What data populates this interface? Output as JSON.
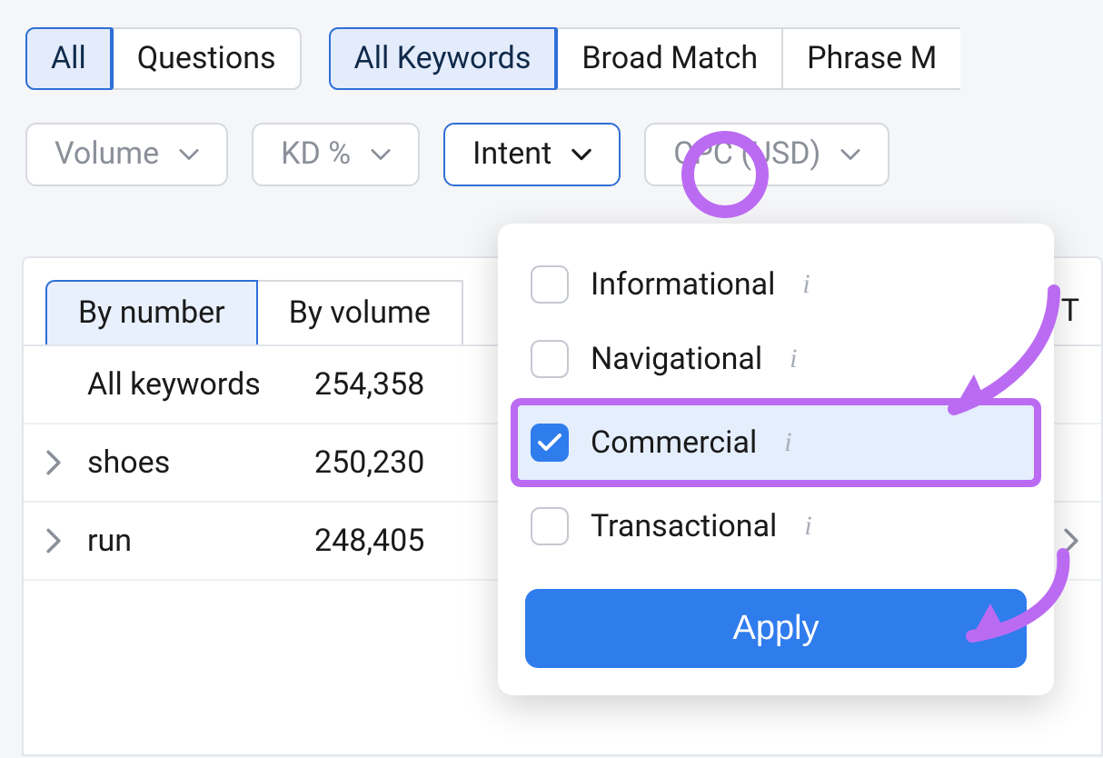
{
  "tabGroups": {
    "type": [
      {
        "label": "All",
        "active": true
      },
      {
        "label": "Questions",
        "active": false
      }
    ],
    "match": [
      {
        "label": "All Keywords",
        "active": true
      },
      {
        "label": "Broad Match",
        "active": false
      },
      {
        "label": "Phrase M",
        "active": false,
        "partial": true
      }
    ]
  },
  "filters": [
    {
      "label": "Volume",
      "open": false
    },
    {
      "label": "KD %",
      "open": false
    },
    {
      "label": "Intent",
      "open": true
    },
    {
      "label": "CPC (USD)",
      "open": false
    }
  ],
  "subtabs": [
    {
      "label": "By number",
      "active": true
    },
    {
      "label": "By volume",
      "active": false
    }
  ],
  "rightColHeader": "T",
  "table": {
    "header": {
      "label": "All keywords",
      "count": "254,358"
    },
    "rows": [
      {
        "label": "shoes",
        "count": "250,230"
      },
      {
        "label": "run",
        "count": "248,405"
      }
    ]
  },
  "intentDropdown": {
    "options": [
      {
        "label": "Informational",
        "checked": false
      },
      {
        "label": "Navigational",
        "checked": false
      },
      {
        "label": "Commercial",
        "checked": true,
        "highlight": true
      },
      {
        "label": "Transactional",
        "checked": false
      }
    ],
    "applyLabel": "Apply"
  },
  "icons": {
    "chevronDown": "chevron-down",
    "chevronRight": "chevron-right",
    "check": "check"
  }
}
